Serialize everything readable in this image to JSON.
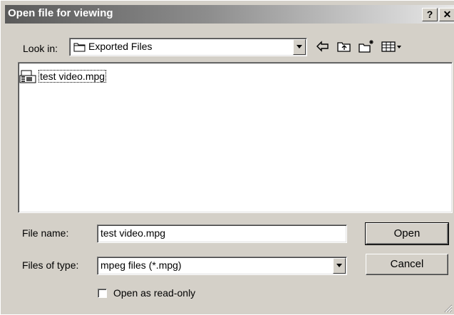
{
  "window": {
    "title": "Open file for viewing",
    "help_label": "?",
    "close_label": "✕"
  },
  "look_in": {
    "label": "Look in:",
    "value": "Exported Files"
  },
  "file_list": {
    "items": [
      {
        "name": "test video.mpg",
        "icon": "video-file-icon"
      }
    ]
  },
  "file_name": {
    "label": "File name:",
    "value": "test video.mpg"
  },
  "files_of_type": {
    "label": "Files of type:",
    "value": "mpeg files (*.mpg)"
  },
  "buttons": {
    "open": "Open",
    "cancel": "Cancel"
  },
  "read_only": {
    "label": "Open as read-only",
    "checked": false
  },
  "toolbar": {
    "back_icon": "back-arrow-icon",
    "up_icon": "up-folder-icon",
    "new_folder_icon": "new-folder-icon",
    "view_menu_icon": "view-menu-icon"
  }
}
